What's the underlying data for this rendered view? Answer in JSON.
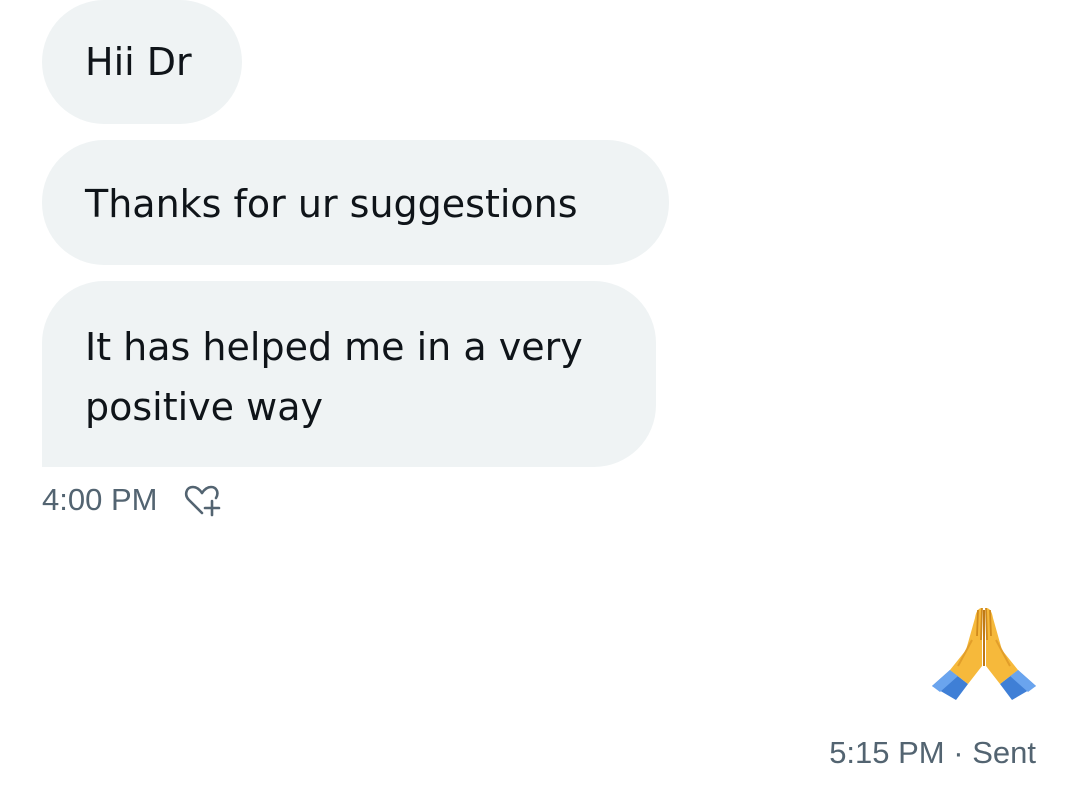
{
  "received": {
    "messages": [
      {
        "text": "Hii Dr"
      },
      {
        "text": "Thanks for ur suggestions"
      },
      {
        "text": "It has helped me in a very\npositive way"
      }
    ],
    "timestamp": "4:00 PM",
    "reaction_icon": "heart-plus-icon"
  },
  "sent": {
    "emoji": "🙏",
    "emoji_icon": "folded-hands-icon",
    "timestamp": "5:15 PM",
    "separator": "·",
    "status": "Sent"
  },
  "colors": {
    "bubble_received": "#eff3f4",
    "text_primary": "#0f1419",
    "text_secondary": "#536471"
  }
}
